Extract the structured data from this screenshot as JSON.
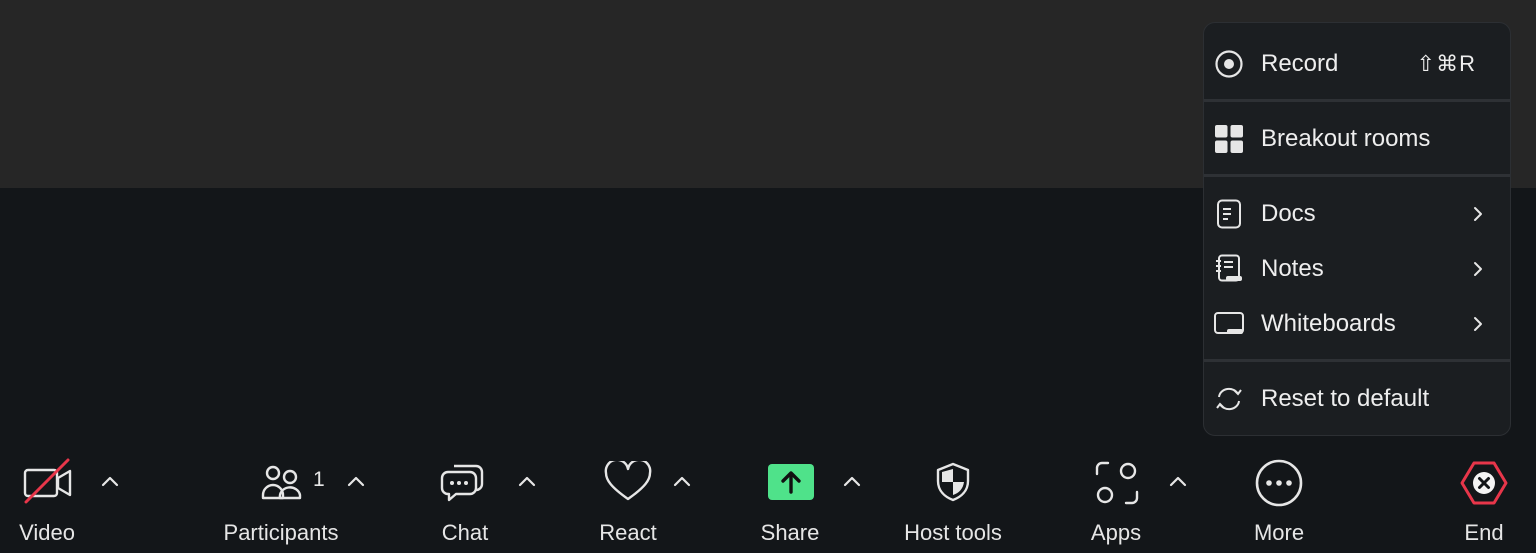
{
  "menu": {
    "items": [
      {
        "label": "Record",
        "shortcut": "⇧⌘R",
        "icon": "record-icon"
      },
      {
        "label": "Breakout rooms",
        "icon": "breakout-rooms-icon"
      },
      {
        "label": "Docs",
        "icon": "docs-icon",
        "has_submenu": true
      },
      {
        "label": "Notes",
        "icon": "notes-icon",
        "has_submenu": true
      },
      {
        "label": "Whiteboards",
        "icon": "whiteboards-icon",
        "has_submenu": true
      },
      {
        "label": "Reset to default",
        "icon": "reset-icon"
      }
    ]
  },
  "toolbar": {
    "video": {
      "label": "Video",
      "icon": "video-off-icon"
    },
    "participants": {
      "label": "Participants",
      "count": "1",
      "icon": "participants-icon"
    },
    "chat": {
      "label": "Chat",
      "icon": "chat-icon"
    },
    "react": {
      "label": "React",
      "icon": "heart-icon"
    },
    "share": {
      "label": "Share",
      "icon": "share-screen-icon"
    },
    "host_tools": {
      "label": "Host tools",
      "icon": "shield-icon"
    },
    "apps": {
      "label": "Apps",
      "icon": "apps-icon"
    },
    "more": {
      "label": "More",
      "icon": "more-icon"
    },
    "end": {
      "label": "End",
      "icon": "end-meeting-icon"
    }
  },
  "colors": {
    "background": "#131619",
    "top_area": "#262626",
    "menu_bg": "#1b1e21",
    "share_green": "#4fe28a",
    "end_red": "#e8364a",
    "video_off_red": "#e8364a"
  }
}
